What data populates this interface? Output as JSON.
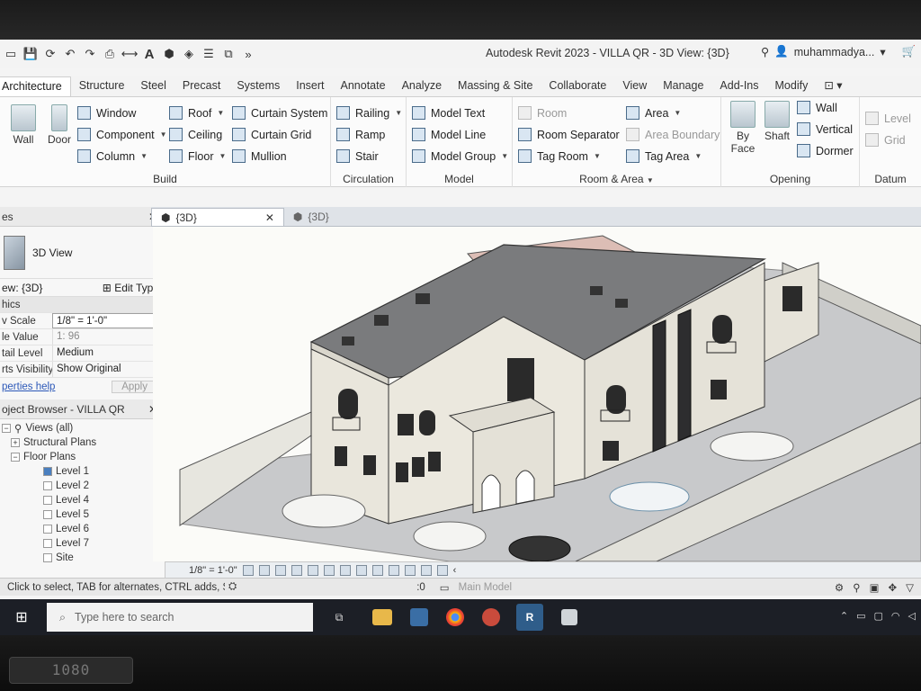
{
  "window": {
    "title": "Autodesk Revit 2023 - VILLA QR - 3D View: {3D}",
    "user": "muhammadya..."
  },
  "ribbon_tabs": [
    "Architecture",
    "Structure",
    "Steel",
    "Precast",
    "Systems",
    "Insert",
    "Annotate",
    "Analyze",
    "Massing & Site",
    "Collaborate",
    "View",
    "Manage",
    "Add-Ins",
    "Modify"
  ],
  "ribbon": {
    "build": {
      "label": "Build",
      "wall": "Wall",
      "door": "Door",
      "window": "Window",
      "component": "Component",
      "column": "Column",
      "roof": "Roof",
      "ceiling": "Ceiling",
      "floor": "Floor",
      "curtain_system": "Curtain System",
      "curtain_grid": "Curtain Grid",
      "mullion": "Mullion"
    },
    "circulation": {
      "label": "Circulation",
      "railing": "Railing",
      "ramp": "Ramp",
      "stair": "Stair"
    },
    "model": {
      "label": "Model",
      "model_text": "Model Text",
      "model_line": "Model Line",
      "model_group": "Model Group"
    },
    "room_area": {
      "label": "Room & Area",
      "room": "Room",
      "room_separator": "Room Separator",
      "tag_room": "Tag Room",
      "area": "Area",
      "area_boundary": "Area Boundary",
      "tag_area": "Tag Area"
    },
    "opening": {
      "label": "Opening",
      "by_face": "By Face",
      "shaft": "Shaft",
      "wall": "Wall",
      "vertical": "Vertical",
      "dormer": "Dormer"
    },
    "datum": {
      "label": "Datum",
      "level": "Level",
      "grid": "Grid"
    }
  },
  "view_tabs": [
    "{3D}",
    "{3D}"
  ],
  "properties": {
    "header": "es",
    "type_name": "3D View",
    "selector": "ew: {3D}",
    "edit_type": "Edit Type",
    "section": "hics",
    "rows": [
      {
        "key": "v Scale",
        "value": "1/8\" = 1'-0\""
      },
      {
        "key": "le Value",
        "value": "1: 96"
      },
      {
        "key": "tail Level",
        "value": "Medium"
      },
      {
        "key": "rts Visibility",
        "value": "Show Original"
      }
    ],
    "help_link": "perties help",
    "apply": "Apply"
  },
  "project_browser": {
    "header": "oject Browser - VILLA QR",
    "views_all": "Views (all)",
    "structural_plans": "Structural Plans",
    "floor_plans": "Floor Plans",
    "levels": [
      "Level 1",
      "Level 2",
      "Level 4",
      "Level 5",
      "Level 6",
      "Level 7",
      "Site"
    ]
  },
  "view_control_bar": {
    "scale": "1/8\" = 1'-0\""
  },
  "status": {
    "message": "Click to select, TAB for alternates, CTRL adds, SHIFT",
    "workset": ":0",
    "main_model": "Main Model"
  },
  "taskbar": {
    "search_placeholder": "Type here to search"
  },
  "bezel": {
    "badge": "1080"
  },
  "colors": {
    "ribbon_bg": "#fbfbfb",
    "taskbar_bg": "#1c1f26",
    "accent_blue": "#2c58b8",
    "model_wall": "#e9e6dc",
    "model_roof": "#7a7b7d"
  }
}
